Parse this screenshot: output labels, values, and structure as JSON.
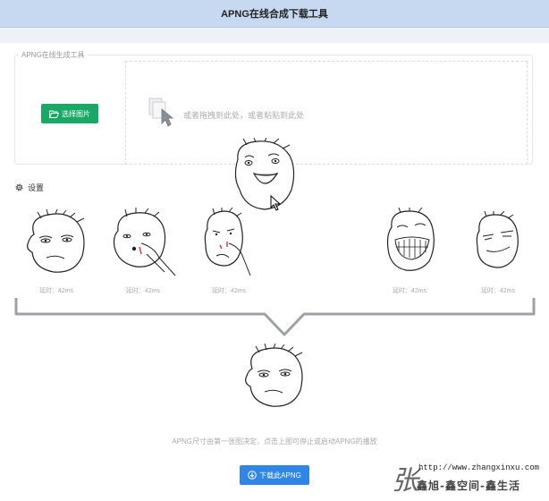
{
  "app": {
    "title": "APNG在线合成下载工具"
  },
  "upload": {
    "legend": "APNG在线生成工具",
    "choose_label": "选择图片",
    "drop_hint": "或者拖拽到此处，或者粘贴到此处"
  },
  "settings": {
    "label": "设置"
  },
  "frames": [
    {
      "delay": "延时：42ms",
      "face": "tired"
    },
    {
      "delay": "延时：42ms",
      "face": "nose-pick"
    },
    {
      "delay": "延时：42ms",
      "face": "nose-pick-small"
    },
    {
      "delay": "延时：42ms",
      "face": "grin"
    },
    {
      "delay": "延时：42ms",
      "face": "smirk"
    }
  ],
  "dragging_frame": {
    "face": "surprised"
  },
  "preview": {
    "face": "tired"
  },
  "note": "APNG尺寸由第一张图决定，点击上图可停止或启动APNG的播放",
  "download": {
    "label": "下载此APNG"
  },
  "watermark": {
    "char": "张",
    "url": "http://www.zhangxinxu.com",
    "slogan": "鑫旭-鑫空间-鑫生活"
  },
  "colors": {
    "title_bar": "#c7d9f1",
    "choose_button": "#1aa866",
    "download_button": "#2f86e5"
  }
}
